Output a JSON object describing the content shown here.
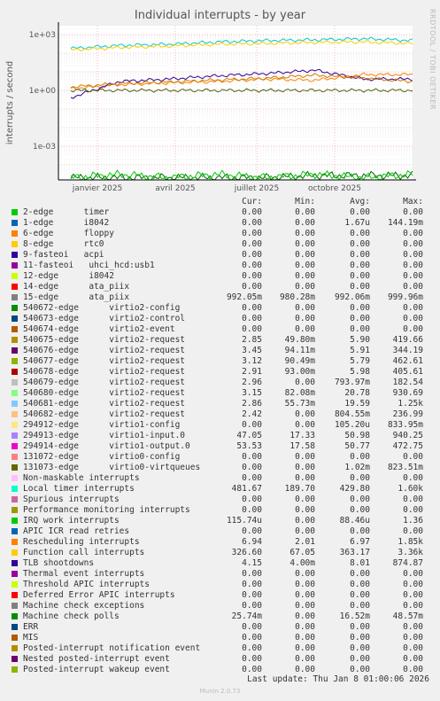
{
  "title": "Individual interrupts - by year",
  "side_label": "RRDTOOL / TOBI OETIKER",
  "footer": "Munin 2.0.73",
  "last_update": "Last update: Thu Jan  8 01:00:06 2026",
  "chart_data": {
    "type": "line",
    "title": "Individual interrupts - by year",
    "ylabel": "interrupts / second",
    "yscale": "log",
    "ylim": [
      1.5e-05,
      3000
    ],
    "y_ticks": [
      {
        "value": 1000,
        "label": "1e+03"
      },
      {
        "value": 1,
        "label": "1e+00"
      },
      {
        "value": 0.001,
        "label": "1e-03"
      }
    ],
    "x_ticks": [
      "janvier 2025",
      "avril 2025",
      "juillet 2025",
      "octobre 2025"
    ],
    "grid": true,
    "series_approx": [
      {
        "name": "Local timer interrupts",
        "color": "#00cccc",
        "values": [
          180,
          260,
          300,
          400,
          480,
          520,
          600,
          480
        ]
      },
      {
        "name": "Function call interrupts",
        "color": "#ffcc00",
        "values": [
          150,
          200,
          240,
          300,
          330,
          380,
          400,
          330
        ]
      },
      {
        "name": "Rescheduling interrupts",
        "color": "#ff8000",
        "values": [
          1.2,
          2,
          2.5,
          3,
          4,
          3.5,
          7,
          7
        ]
      },
      {
        "name": "TLB shootdowns",
        "color": "#330099",
        "values": [
          0.4,
          3,
          4,
          6,
          8,
          12,
          4,
          4
        ]
      },
      {
        "name": "540675-edge",
        "color": "#cc7a00",
        "values": [
          1.5,
          2.3,
          2.8,
          3.6,
          4.5,
          6.5,
          4.5,
          3
        ]
      },
      {
        "name": "15-edge",
        "color": "#4b6615",
        "values": [
          0.99,
          0.99,
          0.99,
          0.99,
          0.99,
          0.99,
          0.99,
          0.99
        ]
      },
      {
        "name": "Machine check polls",
        "color": "#006600",
        "values": [
          2e-05,
          2e-05,
          2e-05,
          2e-05,
          2e-05,
          2.6e-05,
          2.6e-05,
          2.6e-05
        ]
      },
      {
        "name": "IRQ work interrupts",
        "color": "#00cc00",
        "values": [
          2e-05,
          3e-05,
          2e-05,
          3e-05,
          2e-05,
          3e-05,
          2e-05,
          3e-05
        ]
      }
    ],
    "legend_headers": [
      "Cur:",
      "Min:",
      "Avg:",
      "Max:"
    ],
    "legend": [
      {
        "name": "2-edge      timer",
        "color": "#00cc00",
        "cur": "0.00",
        "min": "0.00",
        "avg": "0.00",
        "max": "0.00"
      },
      {
        "name": "1-edge      i8042",
        "color": "#0066b3",
        "cur": "0.00",
        "min": "0.00",
        "avg": "1.67u",
        "max": "144.19m"
      },
      {
        "name": "6-edge      floppy",
        "color": "#ff8000",
        "cur": "0.00",
        "min": "0.00",
        "avg": "0.00",
        "max": "0.00"
      },
      {
        "name": "8-edge      rtc0",
        "color": "#ffcc00",
        "cur": "0.00",
        "min": "0.00",
        "avg": "0.00",
        "max": "0.00"
      },
      {
        "name": "9-fasteoi   acpi",
        "color": "#330099",
        "cur": "0.00",
        "min": "0.00",
        "avg": "0.00",
        "max": "0.00"
      },
      {
        "name": "11-fasteoi   uhci_hcd:usb1",
        "color": "#990099",
        "cur": "0.00",
        "min": "0.00",
        "avg": "0.00",
        "max": "0.00"
      },
      {
        "name": "12-edge      i8042",
        "color": "#ccff00",
        "cur": "0.00",
        "min": "0.00",
        "avg": "0.00",
        "max": "0.00"
      },
      {
        "name": "14-edge      ata_piix",
        "color": "#ff0000",
        "cur": "0.00",
        "min": "0.00",
        "avg": "0.00",
        "max": "0.00"
      },
      {
        "name": "15-edge      ata_piix",
        "color": "#808080",
        "cur": "992.05m",
        "min": "980.28m",
        "avg": "992.06m",
        "max": "999.96m"
      },
      {
        "name": "540672-edge      virtio2-config",
        "color": "#008f00",
        "cur": "0.00",
        "min": "0.00",
        "avg": "0.00",
        "max": "0.00"
      },
      {
        "name": "540673-edge      virtio2-control",
        "color": "#00487d",
        "cur": "0.00",
        "min": "0.00",
        "avg": "0.00",
        "max": "0.00"
      },
      {
        "name": "540674-edge      virtio2-event",
        "color": "#b35a00",
        "cur": "0.00",
        "min": "0.00",
        "avg": "0.00",
        "max": "0.00"
      },
      {
        "name": "540675-edge      virtio2-request",
        "color": "#b38f00",
        "cur": "2.85",
        "min": "49.80m",
        "avg": "5.90",
        "max": "419.66"
      },
      {
        "name": "540676-edge      virtio2-request",
        "color": "#6b006b",
        "cur": "3.45",
        "min": "94.11m",
        "avg": "5.91",
        "max": "344.19"
      },
      {
        "name": "540677-edge      virtio2-request",
        "color": "#8fb300",
        "cur": "3.12",
        "min": "90.49m",
        "avg": "5.79",
        "max": "462.61"
      },
      {
        "name": "540678-edge      virtio2-request",
        "color": "#b30000",
        "cur": "2.91",
        "min": "93.00m",
        "avg": "5.98",
        "max": "405.61"
      },
      {
        "name": "540679-edge      virtio2-request",
        "color": "#bebebe",
        "cur": "2.96",
        "min": "0.00",
        "avg": "793.97m",
        "max": "182.54"
      },
      {
        "name": "540680-edge      virtio2-request",
        "color": "#80ff80",
        "cur": "3.15",
        "min": "82.08m",
        "avg": "20.78",
        "max": "930.69"
      },
      {
        "name": "540681-edge      virtio2-request",
        "color": "#80c9ff",
        "cur": "2.86",
        "min": "55.73m",
        "avg": "19.59",
        "max": "1.25k"
      },
      {
        "name": "540682-edge      virtio2-request",
        "color": "#ffc080",
        "cur": "2.42",
        "min": "0.00",
        "avg": "804.55m",
        "max": "236.99"
      },
      {
        "name": "294912-edge      virtio1-config",
        "color": "#ffe680",
        "cur": "0.00",
        "min": "0.00",
        "avg": "105.20u",
        "max": "833.95m"
      },
      {
        "name": "294913-edge      virtio1-input.0",
        "color": "#aa80ff",
        "cur": "47.05",
        "min": "17.33",
        "avg": "50.98",
        "max": "940.25"
      },
      {
        "name": "294914-edge      virtio1-output.0",
        "color": "#ee00cc",
        "cur": "53.53",
        "min": "17.58",
        "avg": "50.77",
        "max": "472.75"
      },
      {
        "name": "131072-edge      virtio0-config",
        "color": "#ff8080",
        "cur": "0.00",
        "min": "0.00",
        "avg": "0.00",
        "max": "0.00"
      },
      {
        "name": "131073-edge      virtio0-virtqueues",
        "color": "#666600",
        "cur": "0.00",
        "min": "0.00",
        "avg": "1.02m",
        "max": "823.51m"
      },
      {
        "name": "Non-maskable interrupts",
        "color": "#ffbfff",
        "cur": "0.00",
        "min": "0.00",
        "avg": "0.00",
        "max": "0.00"
      },
      {
        "name": "Local timer interrupts",
        "color": "#00ffcc",
        "cur": "481.67",
        "min": "189.70",
        "avg": "429.80",
        "max": "1.60k"
      },
      {
        "name": "Spurious interrupts",
        "color": "#cc6699",
        "cur": "0.00",
        "min": "0.00",
        "avg": "0.00",
        "max": "0.00"
      },
      {
        "name": "Performance monitoring interrupts",
        "color": "#999900",
        "cur": "0.00",
        "min": "0.00",
        "avg": "0.00",
        "max": "0.00"
      },
      {
        "name": "IRQ work interrupts",
        "color": "#00cc00",
        "cur": "115.74u",
        "min": "0.00",
        "avg": "88.46u",
        "max": "1.36"
      },
      {
        "name": "APIC ICR read retries",
        "color": "#0066b3",
        "cur": "0.00",
        "min": "0.00",
        "avg": "0.00",
        "max": "0.00"
      },
      {
        "name": "Rescheduling interrupts",
        "color": "#ff8000",
        "cur": "6.94",
        "min": "2.01",
        "avg": "6.97",
        "max": "1.85k"
      },
      {
        "name": "Function call interrupts",
        "color": "#ffcc00",
        "cur": "326.60",
        "min": "67.05",
        "avg": "363.17",
        "max": "3.36k"
      },
      {
        "name": "TLB shootdowns",
        "color": "#330099",
        "cur": "4.15",
        "min": "4.00m",
        "avg": "8.01",
        "max": "874.87"
      },
      {
        "name": "Thermal event interrupts",
        "color": "#990099",
        "cur": "0.00",
        "min": "0.00",
        "avg": "0.00",
        "max": "0.00"
      },
      {
        "name": "Threshold APIC interrupts",
        "color": "#ccff00",
        "cur": "0.00",
        "min": "0.00",
        "avg": "0.00",
        "max": "0.00"
      },
      {
        "name": "Deferred Error APIC interrupts",
        "color": "#ff0000",
        "cur": "0.00",
        "min": "0.00",
        "avg": "0.00",
        "max": "0.00"
      },
      {
        "name": "Machine check exceptions",
        "color": "#808080",
        "cur": "0.00",
        "min": "0.00",
        "avg": "0.00",
        "max": "0.00"
      },
      {
        "name": "Machine check polls",
        "color": "#008f00",
        "cur": "25.74m",
        "min": "0.00",
        "avg": "16.52m",
        "max": "48.57m"
      },
      {
        "name": "ERR",
        "color": "#00487d",
        "cur": "0.00",
        "min": "0.00",
        "avg": "0.00",
        "max": "0.00"
      },
      {
        "name": "MIS",
        "color": "#b35a00",
        "cur": "0.00",
        "min": "0.00",
        "avg": "0.00",
        "max": "0.00"
      },
      {
        "name": "Posted-interrupt notification event",
        "color": "#b38f00",
        "cur": "0.00",
        "min": "0.00",
        "avg": "0.00",
        "max": "0.00"
      },
      {
        "name": "Nested posted-interrupt event",
        "color": "#6b006b",
        "cur": "0.00",
        "min": "0.00",
        "avg": "0.00",
        "max": "0.00"
      },
      {
        "name": "Posted-interrupt wakeup event",
        "color": "#8fb300",
        "cur": "0.00",
        "min": "0.00",
        "avg": "0.00",
        "max": "0.00"
      }
    ]
  }
}
